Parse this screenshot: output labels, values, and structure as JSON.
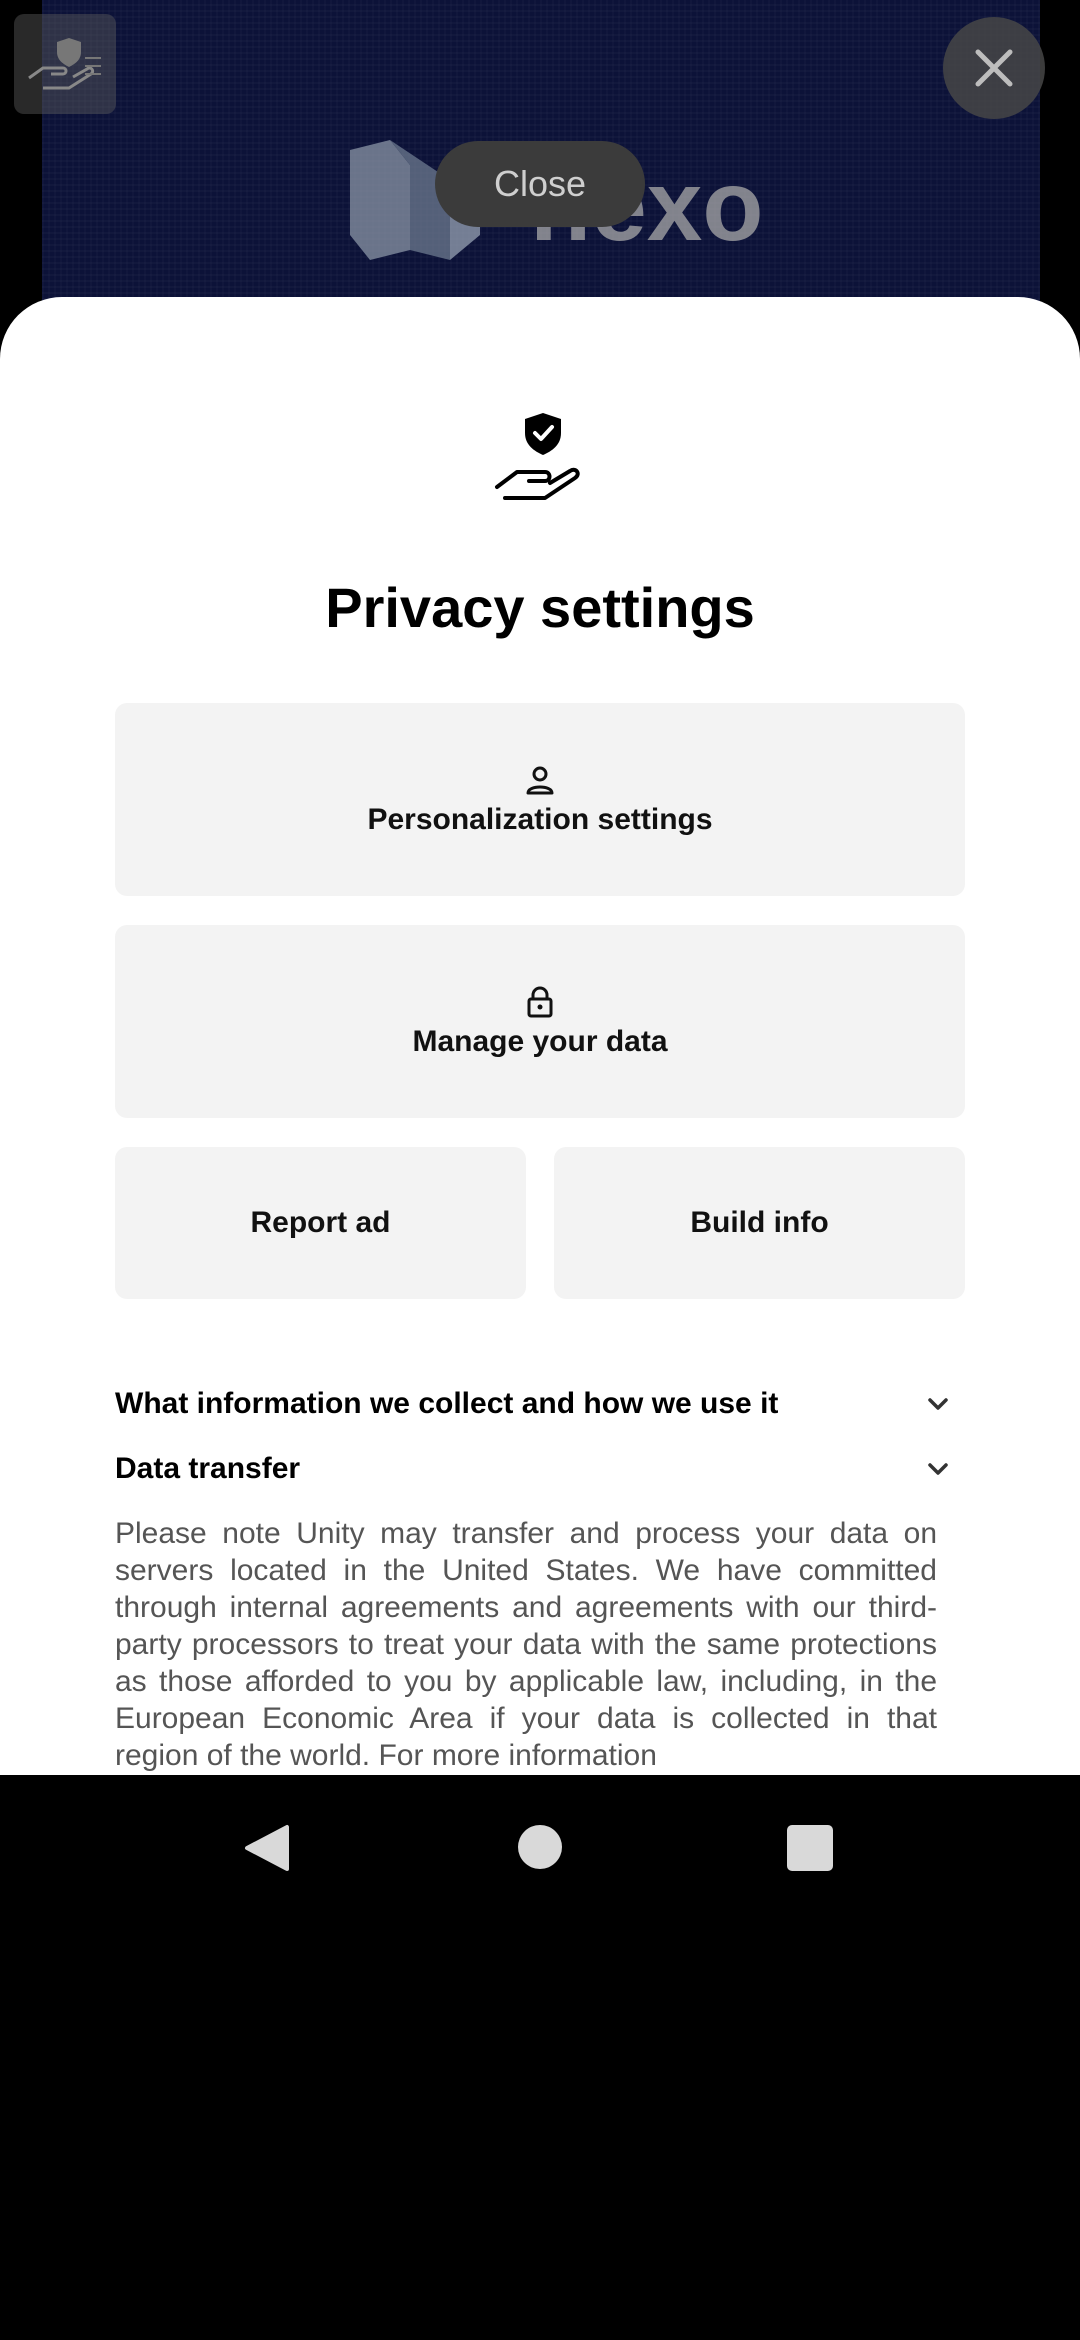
{
  "ad": {
    "close_pill_label": "Close",
    "logo_text": "nexo"
  },
  "sheet": {
    "title": "Privacy settings",
    "buttons": {
      "personalization": "Personalization settings",
      "manage_data": "Manage your data",
      "report_ad": "Report ad",
      "build_info": "Build info"
    },
    "accordion": [
      {
        "label": "What information we collect and how we use it"
      },
      {
        "label": "Data transfer"
      }
    ],
    "body_text": "Please note Unity may transfer and process your data on servers located in the United States. We have committed through internal agreements and agreements with our third-party processors to treat your data with the same protections as those afforded to you by applicable law, including, in the European Economic Area if your data is collected in that region of the world. For more information"
  },
  "icons": {
    "hero": "hand-shield-icon",
    "personalization": "person-icon",
    "manage_data": "lock-icon",
    "chevron": "chevron-down-icon"
  }
}
